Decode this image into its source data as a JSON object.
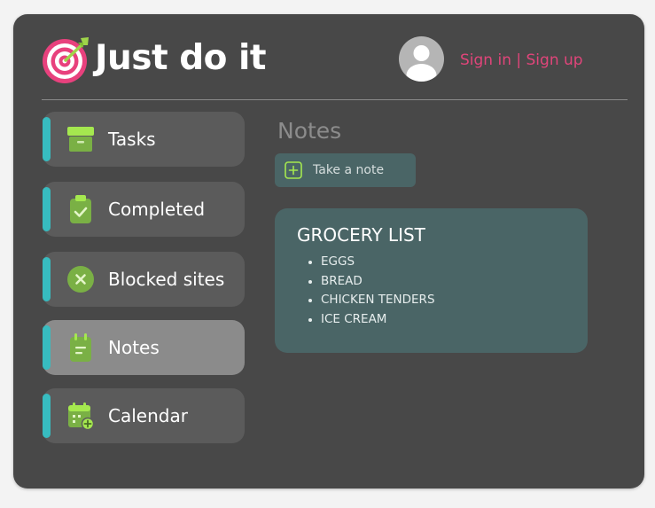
{
  "header": {
    "app_title": "Just do it",
    "auth_link": "Sign in | Sign up",
    "logo_icon": "target-dart-icon",
    "avatar_icon": "user-avatar-icon"
  },
  "sidebar": {
    "items": [
      {
        "label": "Tasks",
        "icon": "archive-box-icon",
        "active": false
      },
      {
        "label": "Completed",
        "icon": "clipboard-check-icon",
        "active": false
      },
      {
        "label": "Blocked sites",
        "icon": "x-circle-icon",
        "active": false
      },
      {
        "label": "Notes",
        "icon": "notepad-icon",
        "active": true
      },
      {
        "label": "Calendar",
        "icon": "calendar-plus-icon",
        "active": false
      }
    ]
  },
  "main": {
    "section_title": "Notes",
    "take_note_placeholder": "Take a note",
    "notes": [
      {
        "title": "GROCERY LIST",
        "items": [
          "EGGS",
          "BREAD",
          "CHICKEN TENDERS",
          "ICE CREAM"
        ]
      }
    ]
  },
  "colors": {
    "window_bg": "#484848",
    "page_bg": "#f3f3f3",
    "nav_item_bg": "#5b5b5b",
    "nav_item_active_bg": "#8b8b8b",
    "nav_accent": "#37bcc0",
    "auth_link": "#e0457a",
    "note_bg": "#4a6566",
    "icon_green": "#8fd04f"
  }
}
